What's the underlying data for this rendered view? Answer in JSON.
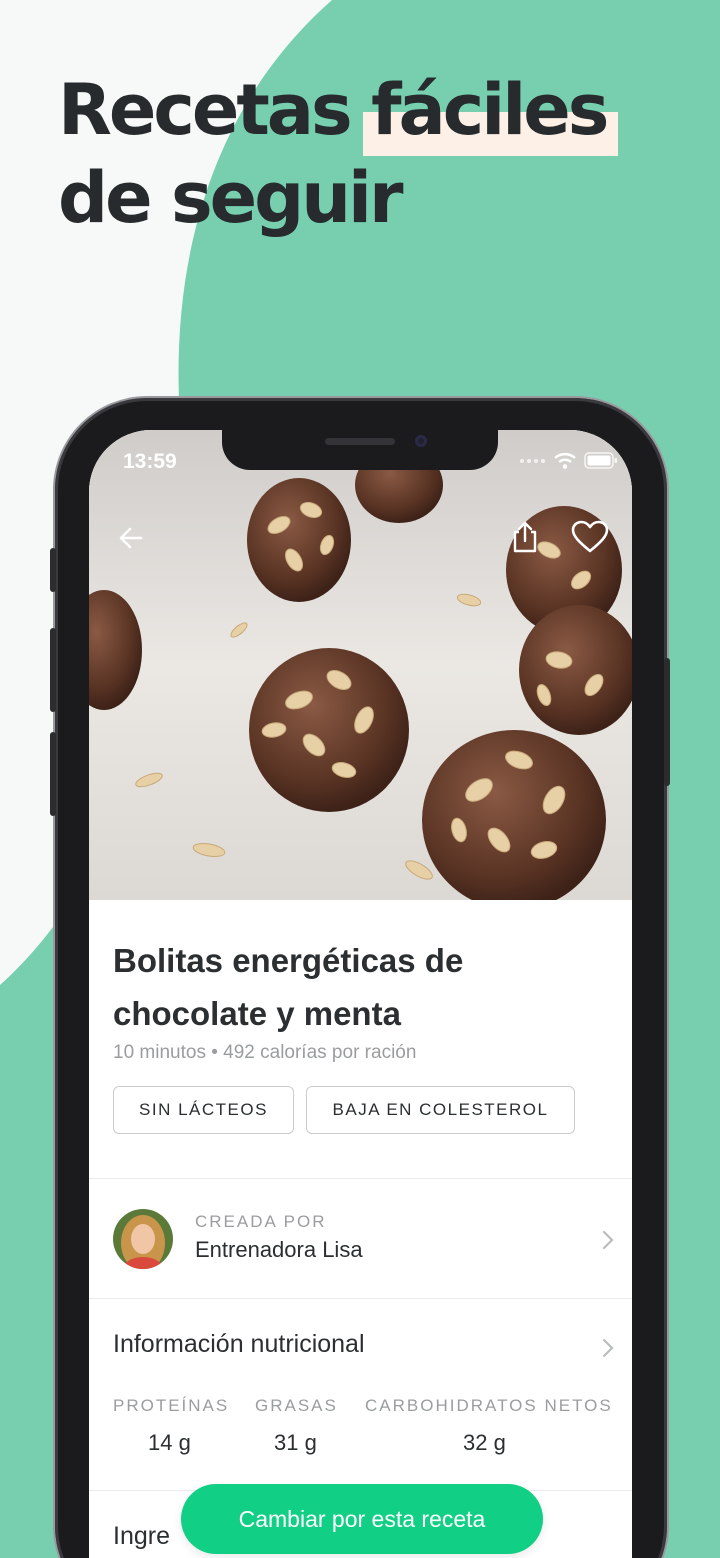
{
  "headline": {
    "line1_a": "Recetas",
    "line1_b": "fáciles",
    "line2": "de seguir"
  },
  "status": {
    "time": "13:59"
  },
  "icons": {
    "back": "arrow-left-icon",
    "share": "share-icon",
    "favorite": "heart-icon",
    "wifi": "wifi-icon",
    "battery": "battery-icon",
    "chevron": "chevron-right-icon"
  },
  "recipe": {
    "title": "Bolitas energéticas de chocolate y menta",
    "meta": "10 minutos • 492 calorías por ración",
    "tags": [
      "SIN LÁCTEOS",
      "BAJA EN COLESTEROL"
    ]
  },
  "author": {
    "label": "CREADA POR",
    "name": "Entrenadora Lisa"
  },
  "nutrition": {
    "title": "Información nutricional",
    "macros": [
      {
        "label": "PROTEÍNAS",
        "value": "14 g"
      },
      {
        "label": "GRASAS",
        "value": "31 g"
      },
      {
        "label": "CARBOHIDRATOS NETOS",
        "value": "32 g"
      }
    ]
  },
  "ingredients": {
    "title_visible": "Ingre"
  },
  "cta": {
    "label": "Cambiar por esta receta"
  },
  "colors": {
    "background_green": "#77cfb0",
    "cta_green": "#12cf86",
    "highlight": "#fdf0e6"
  }
}
